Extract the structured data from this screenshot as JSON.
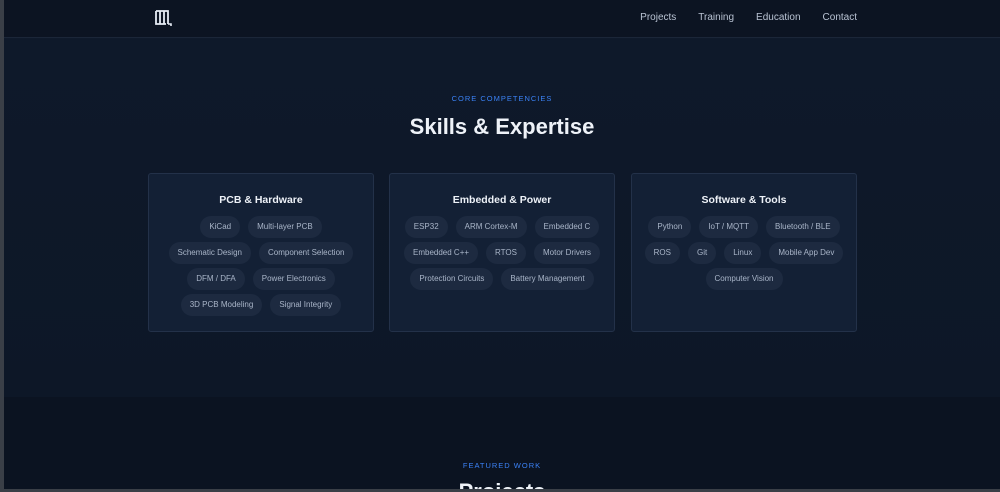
{
  "nav": {
    "logo_icon": "building-logo-icon",
    "links": [
      "Projects",
      "Training",
      "Education",
      "Contact"
    ]
  },
  "skills": {
    "eyebrow": "CORE COMPETENCIES",
    "title": "Skills & Expertise",
    "cards": [
      {
        "title": "PCB & Hardware",
        "tags": [
          "KiCad",
          "Multi-layer PCB",
          "Schematic Design",
          "Component Selection",
          "DFM / DFA",
          "Power Electronics",
          "3D PCB Modeling",
          "Signal Integrity"
        ]
      },
      {
        "title": "Embedded & Power",
        "tags": [
          "ESP32",
          "ARM Cortex-M",
          "Embedded C",
          "Embedded C++",
          "RTOS",
          "Motor Drivers",
          "Protection Circuits",
          "Battery Management"
        ]
      },
      {
        "title": "Software & Tools",
        "tags": [
          "Python",
          "IoT / MQTT",
          "Bluetooth / BLE",
          "ROS",
          "Git",
          "Linux",
          "Mobile App Dev",
          "Computer Vision"
        ]
      }
    ]
  },
  "projects": {
    "eyebrow": "FEATURED WORK",
    "title": "Projects"
  },
  "colors": {
    "accent": "#3b82f6",
    "background": "#0f1a2b",
    "card": "#132035",
    "tag": "#1d2a40"
  }
}
